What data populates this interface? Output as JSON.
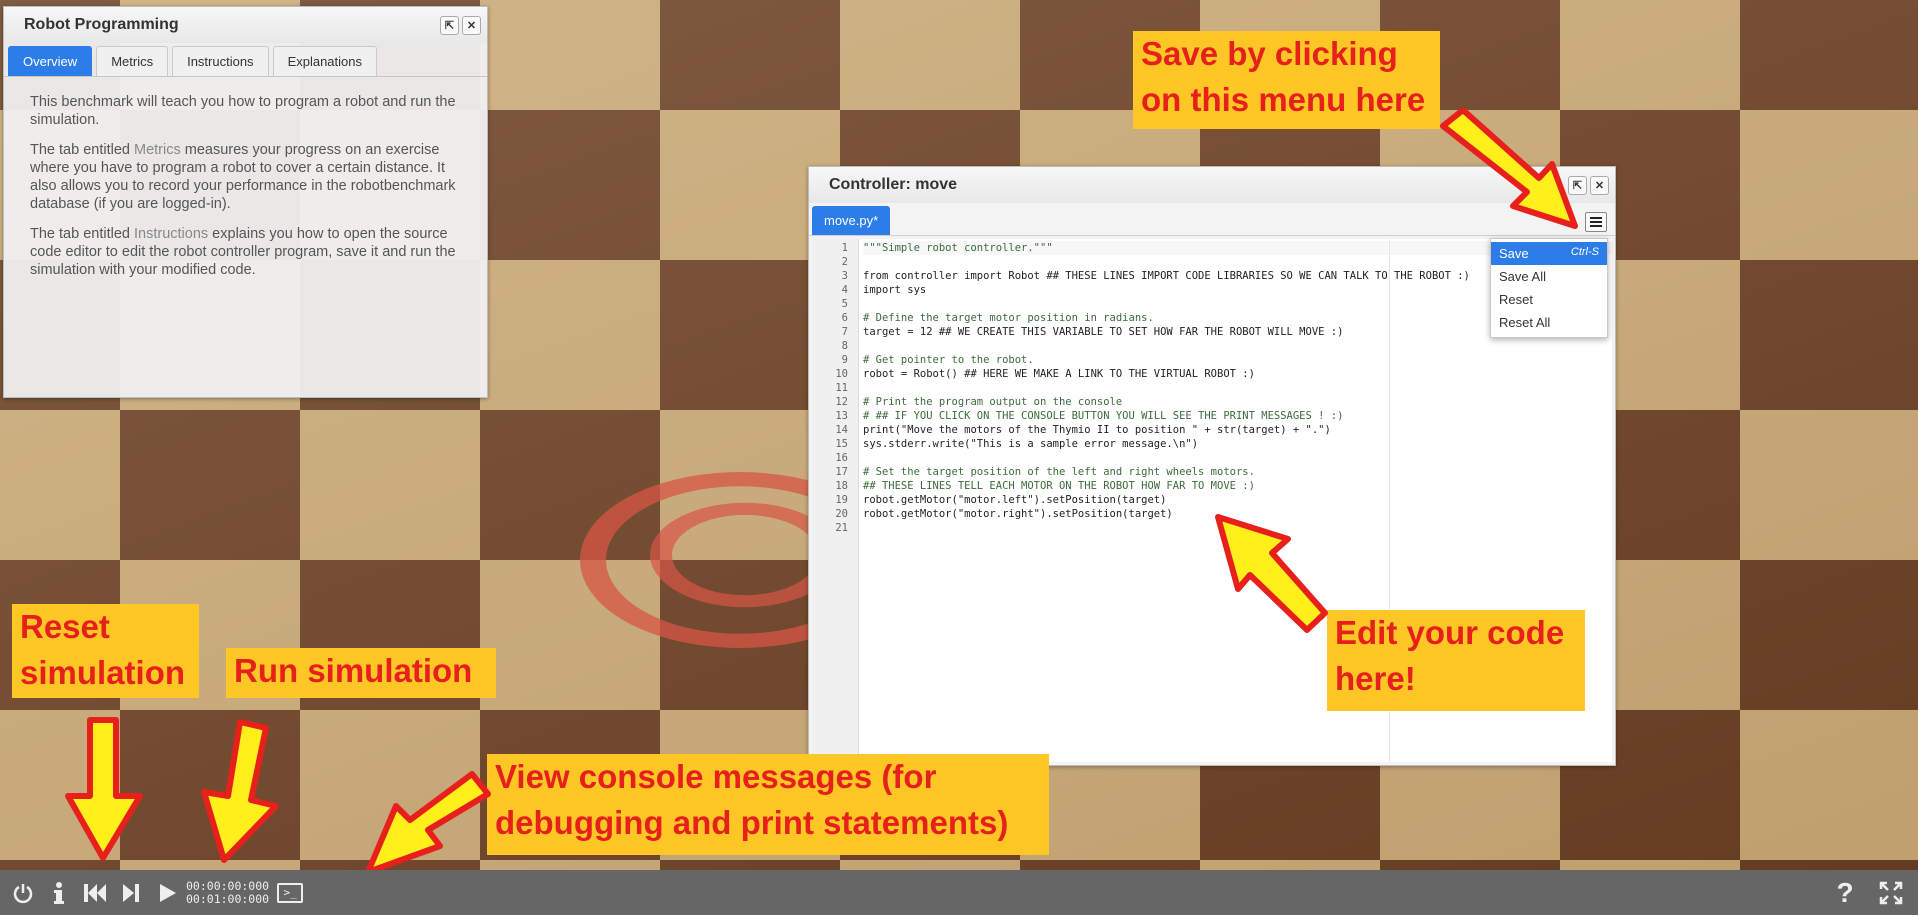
{
  "info_panel": {
    "title": "Robot Programming",
    "tabs": [
      {
        "label": "Overview",
        "active": true
      },
      {
        "label": "Metrics",
        "active": false
      },
      {
        "label": "Instructions",
        "active": false
      },
      {
        "label": "Explanations",
        "active": false
      }
    ],
    "paragraphs": {
      "p1": "This benchmark will teach you how to program a robot and run the simulation.",
      "p2_before": "The tab entitled ",
      "p2_link": "Metrics",
      "p2_after": " measures your progress on an exercise where you have to program a robot to cover a certain distance. It also allows you to record your performance in the robotbenchmark database (if you are logged-in).",
      "p3_before": "The tab entitled ",
      "p3_link": "Instructions",
      "p3_after": " explains you how to open the source code editor to edit the robot controller program, save it and run the simulation with your modified code."
    }
  },
  "editor": {
    "title": "Controller: move",
    "file_tab": "move.py*",
    "lines": [
      {
        "n": "1",
        "text": "\"\"\"Simple robot controller.\"\"\""
      },
      {
        "n": "2",
        "text": ""
      },
      {
        "n": "3",
        "text": "from controller import Robot ## THESE LINES IMPORT CODE LIBRARIES SO WE CAN TALK TO THE ROBOT :)"
      },
      {
        "n": "4",
        "text": "import sys"
      },
      {
        "n": "5",
        "text": ""
      },
      {
        "n": "6",
        "text": "# Define the target motor position in radians."
      },
      {
        "n": "7",
        "text": "target = 12 ## WE CREATE THIS VARIABLE TO SET HOW FAR THE ROBOT WILL MOVE :)"
      },
      {
        "n": "8",
        "text": ""
      },
      {
        "n": "9",
        "text": "# Get pointer to the robot."
      },
      {
        "n": "10",
        "text": "robot = Robot() ## HERE WE MAKE A LINK TO THE VIRTUAL ROBOT :)"
      },
      {
        "n": "11",
        "text": ""
      },
      {
        "n": "12",
        "text": "# Print the program output on the console"
      },
      {
        "n": "13",
        "text": "# ## IF YOU CLICK ON THE CONSOLE BUTTON YOU WILL SEE THE PRINT MESSAGES ! :)"
      },
      {
        "n": "14",
        "text": "print(\"Move the motors of the Thymio II to position \" + str(target) + \".\")"
      },
      {
        "n": "15",
        "text": "sys.stderr.write(\"This is a sample error message.\\n\")"
      },
      {
        "n": "16",
        "text": ""
      },
      {
        "n": "17",
        "text": "# Set the target position of the left and right wheels motors."
      },
      {
        "n": "18",
        "text": "## THESE LINES TELL EACH MOTOR ON THE ROBOT HOW FAR TO MOVE :)"
      },
      {
        "n": "19",
        "text": "robot.getMotor(\"motor.left\").setPosition(target)"
      },
      {
        "n": "20",
        "text": "robot.getMotor(\"motor.right\").setPosition(target)"
      },
      {
        "n": "21",
        "text": ""
      }
    ],
    "menu": {
      "save": "Save",
      "save_shortcut": "Ctrl-S",
      "save_all": "Save All",
      "reset": "Reset",
      "reset_all": "Reset All"
    }
  },
  "annotations": {
    "save_menu": "Save by clicking on this menu here",
    "edit_code": "Edit your code here!",
    "reset_sim": "Reset simulation",
    "run_sim": "Run simulation",
    "console": "View console messages (for debugging and print statements)"
  },
  "toolbar": {
    "time_elapsed": "00:00:00:000",
    "time_limit": "00:01:00:000",
    "help_glyph": "?"
  },
  "colors": {
    "accent": "#2d7de9",
    "annotation_bg": "#ffc726",
    "annotation_text": "#e8201c",
    "arrow_fill": "#ffef1a",
    "arrow_stroke": "#e8201c"
  }
}
